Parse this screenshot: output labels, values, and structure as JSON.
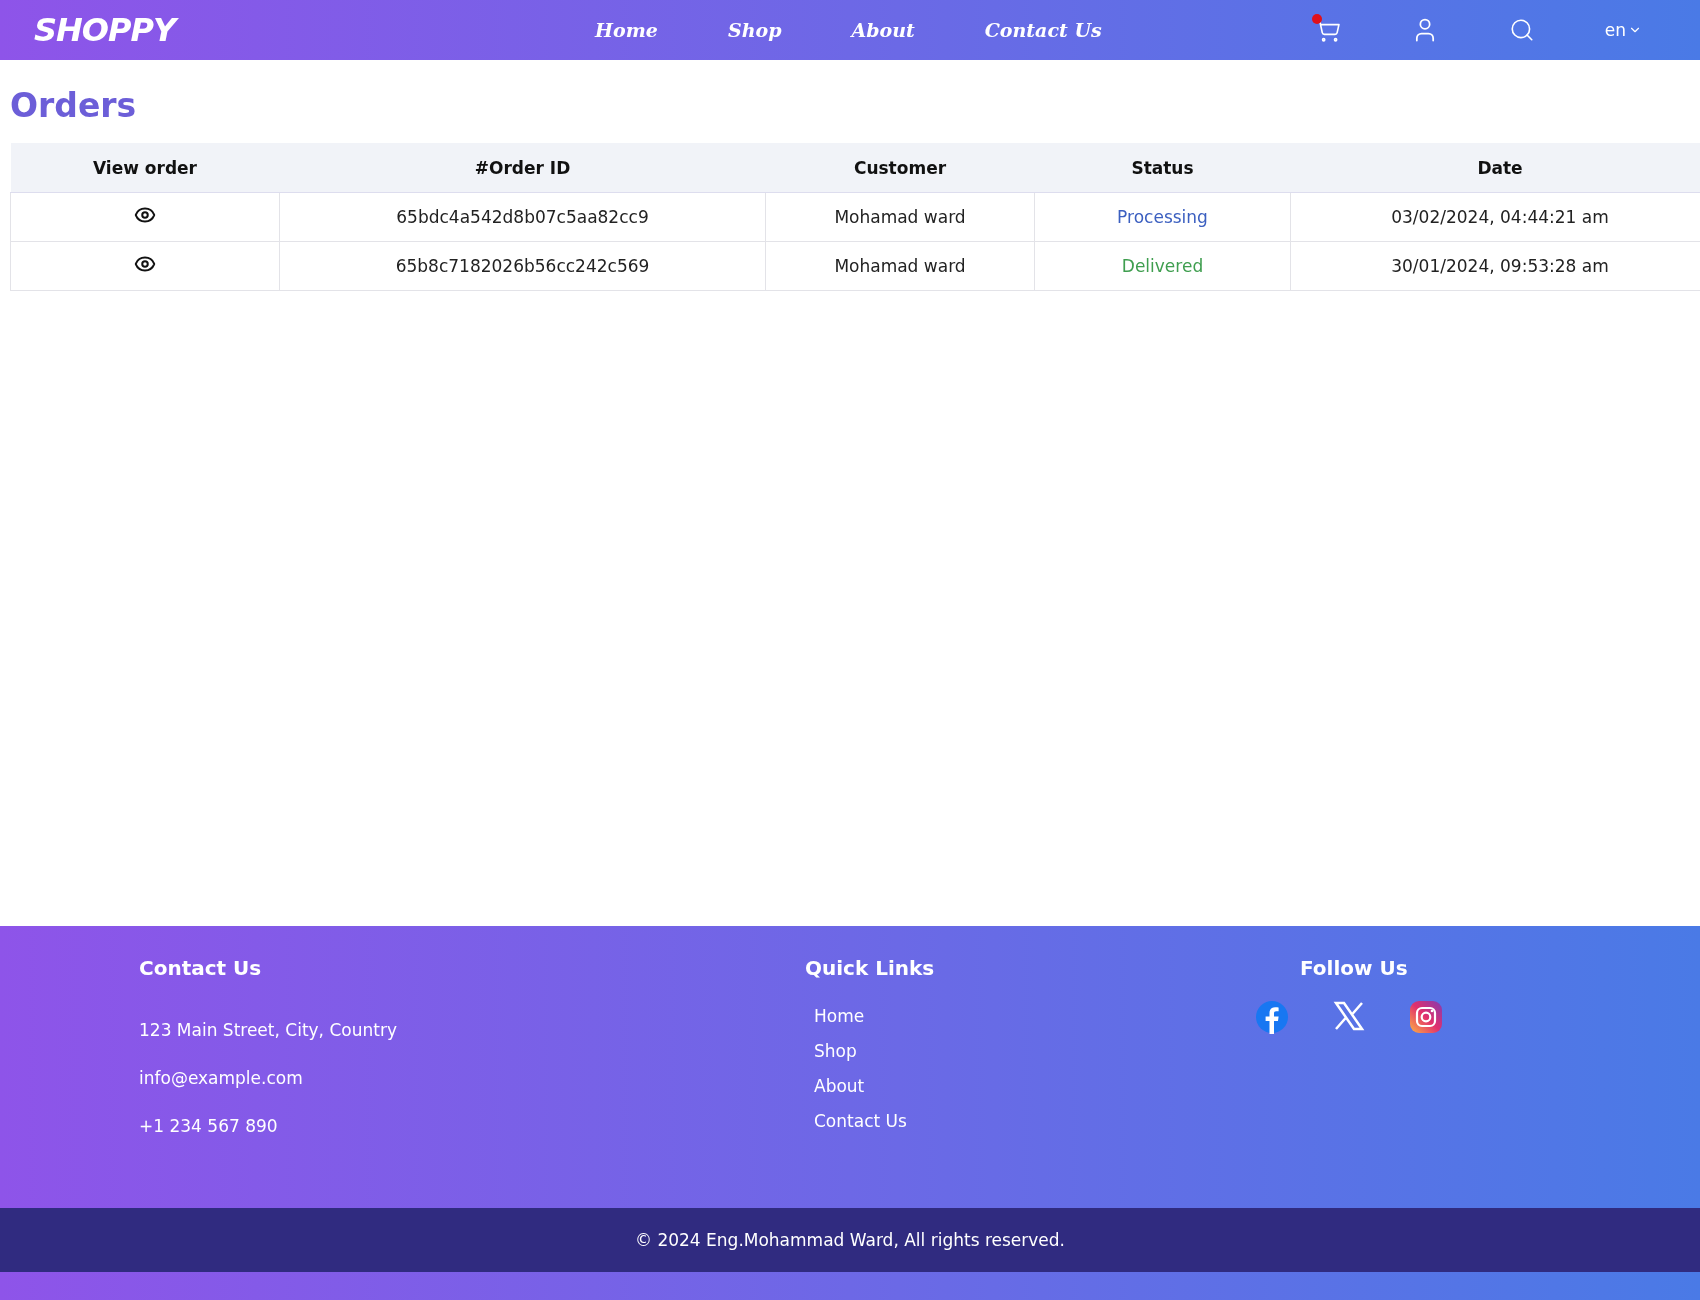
{
  "header": {
    "logo": "SHOPPY",
    "nav": [
      {
        "label": "Home"
      },
      {
        "label": "Shop"
      },
      {
        "label": "About"
      },
      {
        "label": "Contact Us"
      }
    ],
    "cart_badge": true,
    "language": "en"
  },
  "page": {
    "title": "Orders"
  },
  "table": {
    "columns": [
      "View order",
      "#Order ID",
      "Customer",
      "Status",
      "Date"
    ],
    "rows": [
      {
        "order_id": "65bdc4a542d8b07c5aa82cc9",
        "customer": "Mohamad ward",
        "status": "Processing",
        "color": "#3b5fc0",
        "date": "03/02/2024, 04:44:21 am"
      },
      {
        "order_id": "65b8c7182026b56cc242c569",
        "customer": "Mohamad ward",
        "status": "Delivered",
        "color": "#3f9e4f",
        "date": "30/01/2024, 09:53:28 am"
      }
    ]
  },
  "footer": {
    "contact": {
      "title": "Contact Us",
      "lines": [
        "123 Main Street, City, Country",
        "info@example.com",
        "+1 234 567 890"
      ]
    },
    "quick_links": {
      "title": "Quick Links",
      "links": [
        "Home",
        "Shop",
        "About",
        "Contact Us"
      ]
    },
    "follow": {
      "title": "Follow Us",
      "networks": [
        {
          "kind": "facebook"
        },
        {
          "kind": "x"
        },
        {
          "kind": "instagram"
        }
      ]
    },
    "copyright": "© 2024 Eng.Mohammad Ward, All rights reserved."
  }
}
